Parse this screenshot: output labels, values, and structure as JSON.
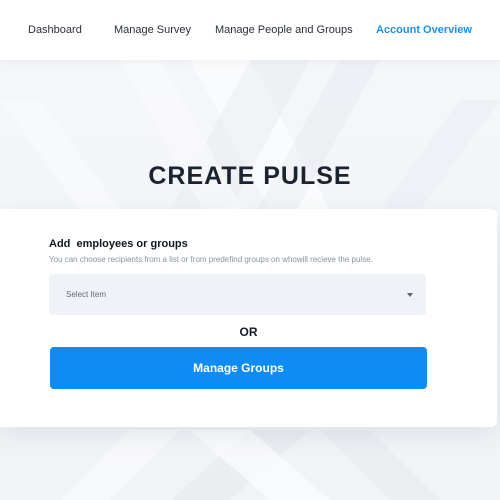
{
  "nav": {
    "items": [
      {
        "label": "Dashboard"
      },
      {
        "label": "Manage Survey"
      },
      {
        "label": "Manage People and Groups"
      },
      {
        "label": "Account  Overview"
      }
    ]
  },
  "page": {
    "title": "CREATE PULSE"
  },
  "card": {
    "heading": "Add  employees or groups",
    "subtext": "You can choose recipients from a list or from predefind groups on whowill recieve the pulse.",
    "select": {
      "value": "Select Item",
      "icon": "caret-down-icon"
    },
    "or_label": "OR",
    "button_label": "Manage Groups"
  },
  "colors": {
    "accent": "#1a8ff0",
    "button": "#0f8bf5",
    "background": "#f2f4f7",
    "select_bg": "#eff2f6"
  }
}
